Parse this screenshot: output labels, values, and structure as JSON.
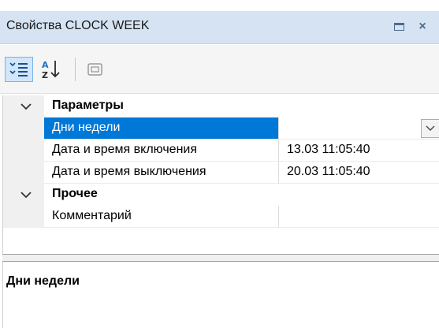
{
  "window": {
    "title": "Свойства CLOCK WEEK",
    "maximize_icon": "window-maximize-icon",
    "close_icon": "close-icon",
    "close_glyph": "×"
  },
  "toolbar": {
    "buttons": [
      {
        "name": "categorized-icon",
        "active": true
      },
      {
        "name": "sort-alphabetical-icon",
        "active": false
      },
      {
        "name": "property-pages-icon",
        "active": false
      }
    ]
  },
  "grid": {
    "categories": [
      {
        "label": "Параметры",
        "expanded": true,
        "properties": [
          {
            "name": "Дни недели",
            "value": "",
            "selected": true,
            "has_dropdown": true
          },
          {
            "name": "Дата и время включения",
            "value": "13.03 11:05:40",
            "selected": false
          },
          {
            "name": "Дата и время выключения",
            "value": "20.03 11:05:40",
            "selected": false
          }
        ]
      },
      {
        "label": "Прочее",
        "expanded": true,
        "properties": [
          {
            "name": "Комментарий",
            "value": "",
            "selected": false
          }
        ]
      }
    ]
  },
  "description": {
    "title": "Дни недели",
    "text": ""
  },
  "colors": {
    "titlebar_bg": "#d5e3f3",
    "selection": "#0078d7",
    "gutter": "#f0f0f0"
  }
}
